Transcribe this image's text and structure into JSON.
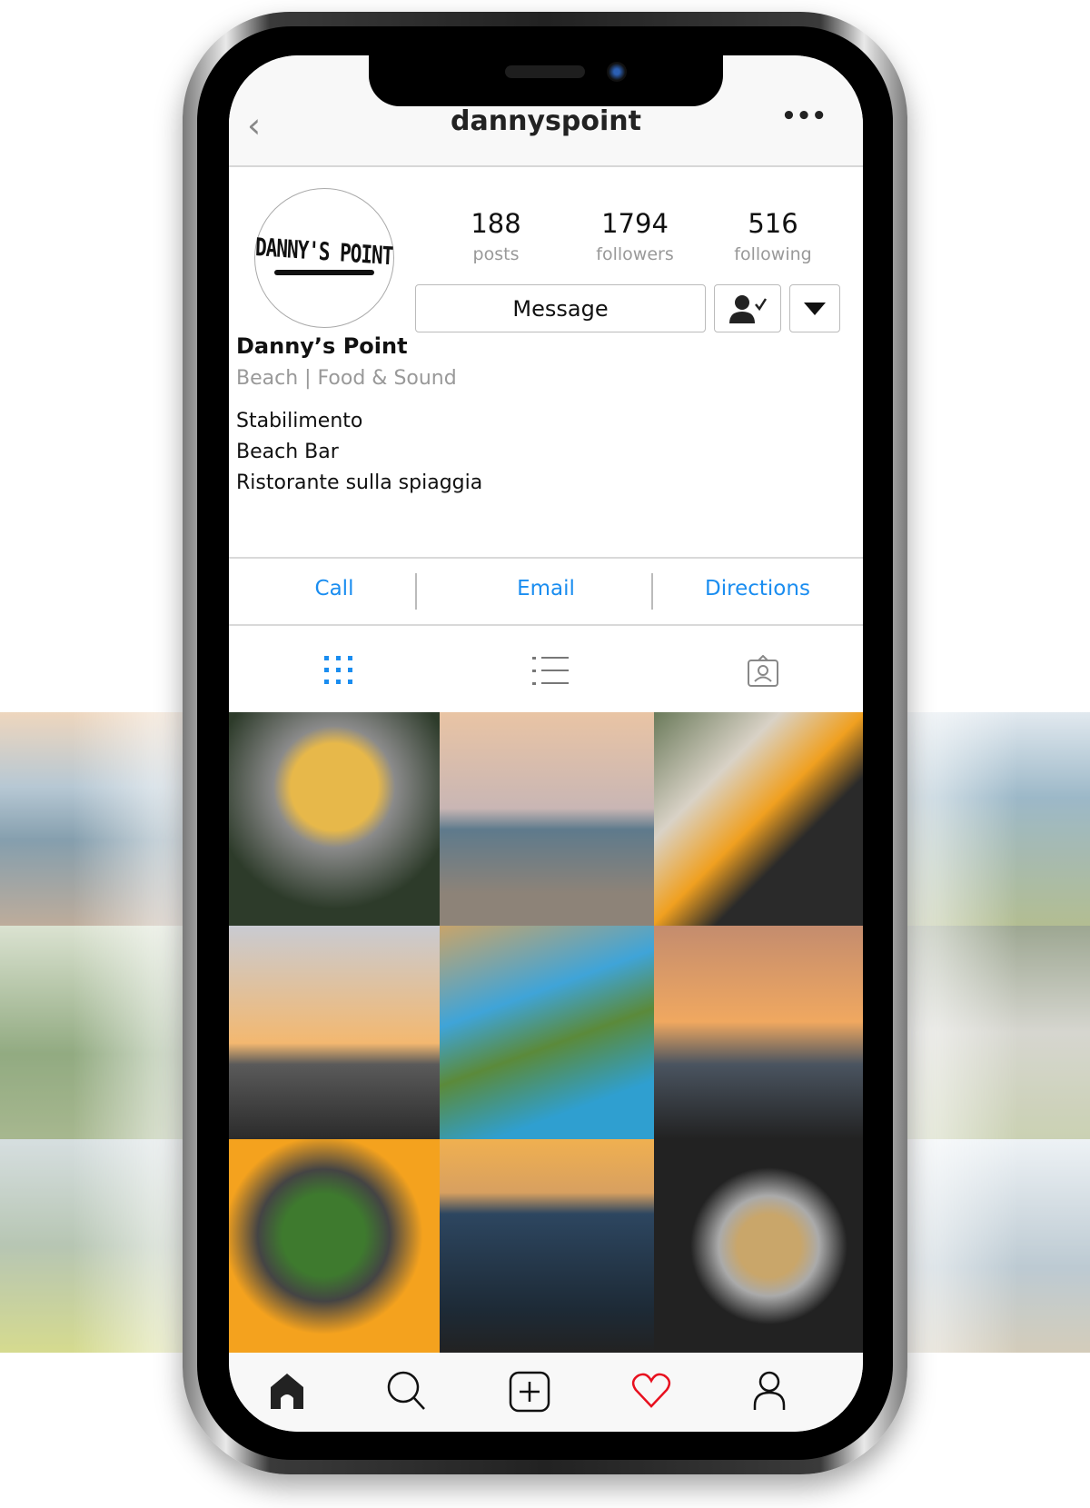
{
  "header": {
    "username": "dannyspoint",
    "back_icon": "chevron-left-icon",
    "more_icon": "more-icon"
  },
  "profile": {
    "avatar_logo_text": "DANNY'S POINT",
    "stats": [
      {
        "value": "188",
        "label": "posts"
      },
      {
        "value": "1794",
        "label": "followers"
      },
      {
        "value": "516",
        "label": "following"
      }
    ],
    "message_label": "Message",
    "name": "Danny’s Point",
    "category": "Beach | Food & Sound",
    "bio": [
      "Stabilimento",
      "Beach Bar",
      "Ristorante sulla spiaggia"
    ]
  },
  "actions": [
    "Call",
    "Email",
    "Directions"
  ],
  "accent": "#1a8df0",
  "tabs": [
    "grid-icon",
    "list-icon",
    "tagged-icon"
  ],
  "nav": [
    "home-icon",
    "search-icon",
    "add-post-icon",
    "heart-icon",
    "profile-icon"
  ],
  "like_color": "#e8101f"
}
